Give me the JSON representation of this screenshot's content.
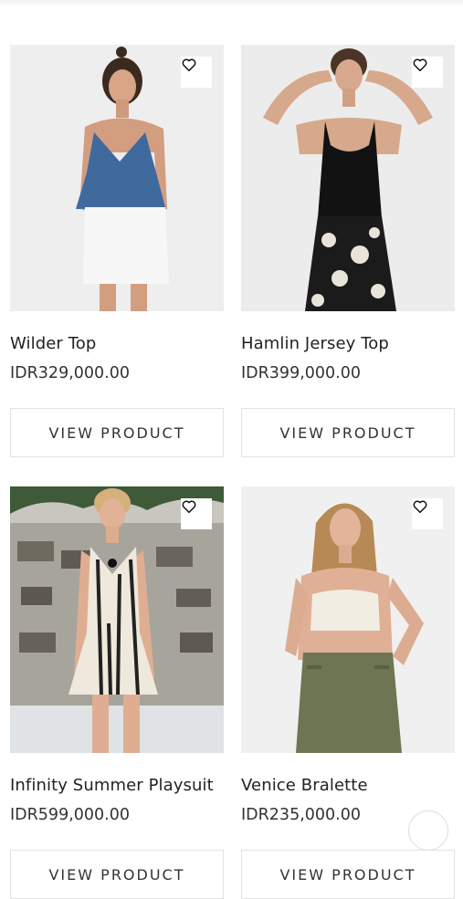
{
  "products": [
    {
      "name": "Wilder Top",
      "price": "IDR329,000.00",
      "button": "VIEW PRODUCT",
      "wishlist_icon": "heart-icon"
    },
    {
      "name": "Hamlin Jersey Top",
      "price": "IDR399,000.00",
      "button": "VIEW PRODUCT",
      "wishlist_icon": "heart-icon"
    },
    {
      "name": "Infinity Summer Playsuit",
      "price": "IDR599,000.00",
      "button": "VIEW PRODUCT",
      "wishlist_icon": "heart-icon"
    },
    {
      "name": "Venice Bralette",
      "price": "IDR235,000.00",
      "button": "VIEW PRODUCT",
      "wishlist_icon": "heart-icon"
    }
  ],
  "colors": {
    "background": "#ffffff",
    "text": "#222222",
    "button_border": "#e2e2e2",
    "photo_bg": "#efefef"
  }
}
